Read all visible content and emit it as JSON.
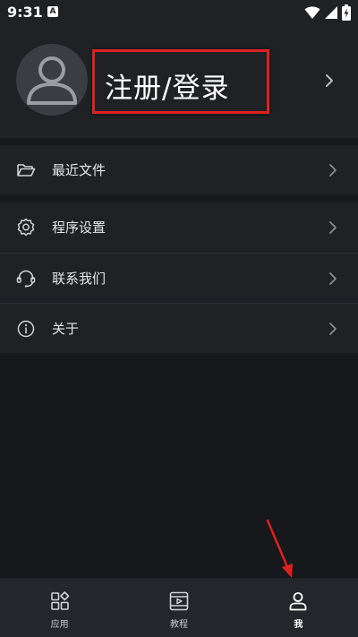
{
  "status_bar": {
    "time": "9:31",
    "app_badge": "A",
    "icons": [
      "wifi-icon",
      "signal-icon",
      "battery-charging-icon"
    ]
  },
  "profile": {
    "login_label": "注册/登录",
    "avatar_icon": "default-avatar-icon",
    "chevron_icon": "chevron-right-icon"
  },
  "menu": {
    "group1": [
      {
        "label": "最近文件",
        "icon": "folder-open-icon"
      }
    ],
    "group2": [
      {
        "label": "程序设置",
        "icon": "gear-icon"
      },
      {
        "label": "联系我们",
        "icon": "headset-icon"
      },
      {
        "label": "关于",
        "icon": "info-icon"
      }
    ]
  },
  "bottom_nav": {
    "items": [
      {
        "label": "应用",
        "icon": "apps-grid-icon",
        "active": false
      },
      {
        "label": "教程",
        "icon": "video-tutorial-icon",
        "active": false
      },
      {
        "label": "我",
        "icon": "person-icon",
        "active": true
      }
    ]
  },
  "colors": {
    "background": "#16181c",
    "panel": "#1f2125",
    "nav_bar": "#24262b",
    "highlight_box": "#e0201f",
    "text_primary": "#e6e6e6"
  }
}
